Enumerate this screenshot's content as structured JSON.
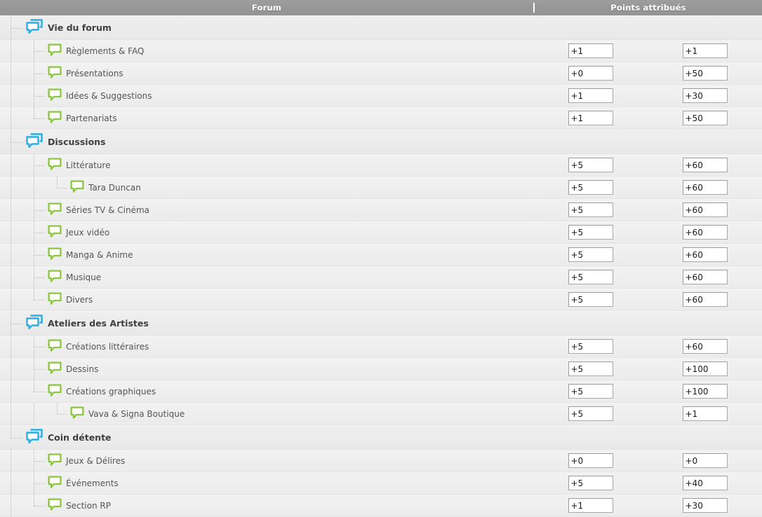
{
  "header": {
    "columns": [
      {
        "label": "Forum"
      },
      {
        "label": "Points attribués"
      }
    ]
  },
  "colors": {
    "header_bg": "#999999",
    "category_icon": "#29aee4",
    "forum_icon": "#8cc63f",
    "row_bg": "#eeeeee",
    "input_border": "#a9a9a9",
    "text": "#555555"
  },
  "icons": {
    "category": "stacked-speech-bubble-icon",
    "forum": "speech-bubble-icon"
  },
  "rows": [
    {
      "level": 0,
      "type": "category",
      "name": "Vie du forum",
      "icon": "stacked-speech-bubble-icon",
      "points": [
        null,
        null
      ],
      "last": false
    },
    {
      "level": 1,
      "type": "forum",
      "name": "Règlements & FAQ",
      "icon": "speech-bubble-icon",
      "points": [
        "+1",
        "+1"
      ],
      "last": false
    },
    {
      "level": 1,
      "type": "forum",
      "name": "Présentations",
      "icon": "speech-bubble-icon",
      "points": [
        "+0",
        "+50"
      ],
      "last": false
    },
    {
      "level": 1,
      "type": "forum",
      "name": "Idées & Suggestions",
      "icon": "speech-bubble-icon",
      "points": [
        "+1",
        "+30"
      ],
      "last": false
    },
    {
      "level": 1,
      "type": "forum",
      "name": "Partenariats",
      "icon": "speech-bubble-icon",
      "points": [
        "+1",
        "+50"
      ],
      "last": true
    },
    {
      "level": 0,
      "type": "category",
      "name": "Discussions",
      "icon": "stacked-speech-bubble-icon",
      "points": [
        null,
        null
      ],
      "last": false
    },
    {
      "level": 1,
      "type": "forum",
      "name": "Littérature",
      "icon": "speech-bubble-icon",
      "points": [
        "+5",
        "+60"
      ],
      "last": false
    },
    {
      "level": 2,
      "type": "forum",
      "name": "Tara Duncan",
      "icon": "speech-bubble-icon",
      "points": [
        "+5",
        "+60"
      ],
      "last": true
    },
    {
      "level": 1,
      "type": "forum",
      "name": "Séries TV & Cinéma",
      "icon": "speech-bubble-icon",
      "points": [
        "+5",
        "+60"
      ],
      "last": false
    },
    {
      "level": 1,
      "type": "forum",
      "name": "Jeux vidéo",
      "icon": "speech-bubble-icon",
      "points": [
        "+5",
        "+60"
      ],
      "last": false
    },
    {
      "level": 1,
      "type": "forum",
      "name": "Manga & Anime",
      "icon": "speech-bubble-icon",
      "points": [
        "+5",
        "+60"
      ],
      "last": false
    },
    {
      "level": 1,
      "type": "forum",
      "name": "Musique",
      "icon": "speech-bubble-icon",
      "points": [
        "+5",
        "+60"
      ],
      "last": false
    },
    {
      "level": 1,
      "type": "forum",
      "name": "Divers",
      "icon": "speech-bubble-icon",
      "points": [
        "+5",
        "+60"
      ],
      "last": true
    },
    {
      "level": 0,
      "type": "category",
      "name": "Ateliers des Artistes",
      "icon": "stacked-speech-bubble-icon",
      "points": [
        null,
        null
      ],
      "last": false
    },
    {
      "level": 1,
      "type": "forum",
      "name": "Créations littéraires",
      "icon": "speech-bubble-icon",
      "points": [
        "+5",
        "+60"
      ],
      "last": false
    },
    {
      "level": 1,
      "type": "forum",
      "name": "Dessins",
      "icon": "speech-bubble-icon",
      "points": [
        "+5",
        "+100"
      ],
      "last": false
    },
    {
      "level": 1,
      "type": "forum",
      "name": "Créations graphiques",
      "icon": "speech-bubble-icon",
      "points": [
        "+5",
        "+100"
      ],
      "last": true
    },
    {
      "level": 2,
      "type": "forum",
      "name": "Vava & Signa Boutique",
      "icon": "speech-bubble-icon",
      "points": [
        "+5",
        "+1"
      ],
      "last": true
    },
    {
      "level": 0,
      "type": "category",
      "name": "Coin détente",
      "icon": "stacked-speech-bubble-icon",
      "points": [
        null,
        null
      ],
      "last": true
    },
    {
      "level": 1,
      "type": "forum",
      "name": "Jeux & Délires",
      "icon": "speech-bubble-icon",
      "points": [
        "+0",
        "+0"
      ],
      "last": false
    },
    {
      "level": 1,
      "type": "forum",
      "name": "Événements",
      "icon": "speech-bubble-icon",
      "points": [
        "+5",
        "+40"
      ],
      "last": false
    },
    {
      "level": 1,
      "type": "forum",
      "name": "Section RP",
      "icon": "speech-bubble-icon",
      "points": [
        "+1",
        "+30"
      ],
      "last": true
    }
  ]
}
